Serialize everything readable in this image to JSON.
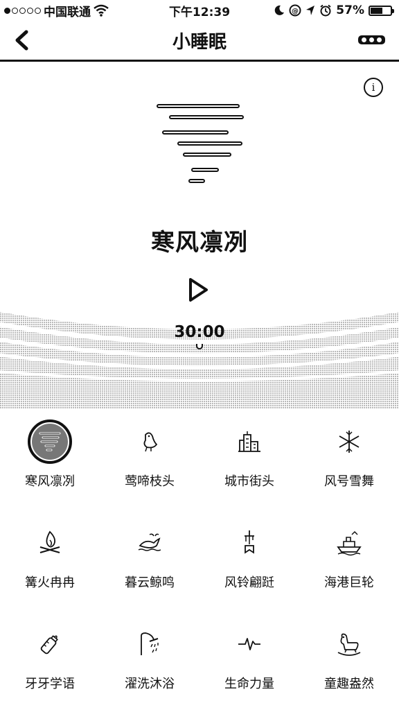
{
  "status_bar": {
    "carrier": "中国联通",
    "time": "下午12:39",
    "battery": "57%",
    "battery_level": 0.57
  },
  "nav": {
    "title": "小睡眠"
  },
  "player": {
    "title": "寒风凛冽",
    "timer": "30:00"
  },
  "sounds": [
    {
      "label": "寒风凛冽",
      "icon": "wind-icon",
      "selected": true
    },
    {
      "label": "莺啼枝头",
      "icon": "bird-icon",
      "selected": false
    },
    {
      "label": "城市街头",
      "icon": "city-icon",
      "selected": false
    },
    {
      "label": "风号雪舞",
      "icon": "snowflake-icon",
      "selected": false
    },
    {
      "label": "篝火冉冉",
      "icon": "campfire-icon",
      "selected": false
    },
    {
      "label": "暮云鲸鸣",
      "icon": "whale-icon",
      "selected": false
    },
    {
      "label": "风铃翩跹",
      "icon": "windchime-icon",
      "selected": false
    },
    {
      "label": "海港巨轮",
      "icon": "ship-icon",
      "selected": false
    },
    {
      "label": "牙牙学语",
      "icon": "baby-bottle-icon",
      "selected": false
    },
    {
      "label": "濯洗沐浴",
      "icon": "shower-icon",
      "selected": false
    },
    {
      "label": "生命力量",
      "icon": "heartbeat-icon",
      "selected": false
    },
    {
      "label": "童趣盎然",
      "icon": "rocking-horse-icon",
      "selected": false
    }
  ]
}
